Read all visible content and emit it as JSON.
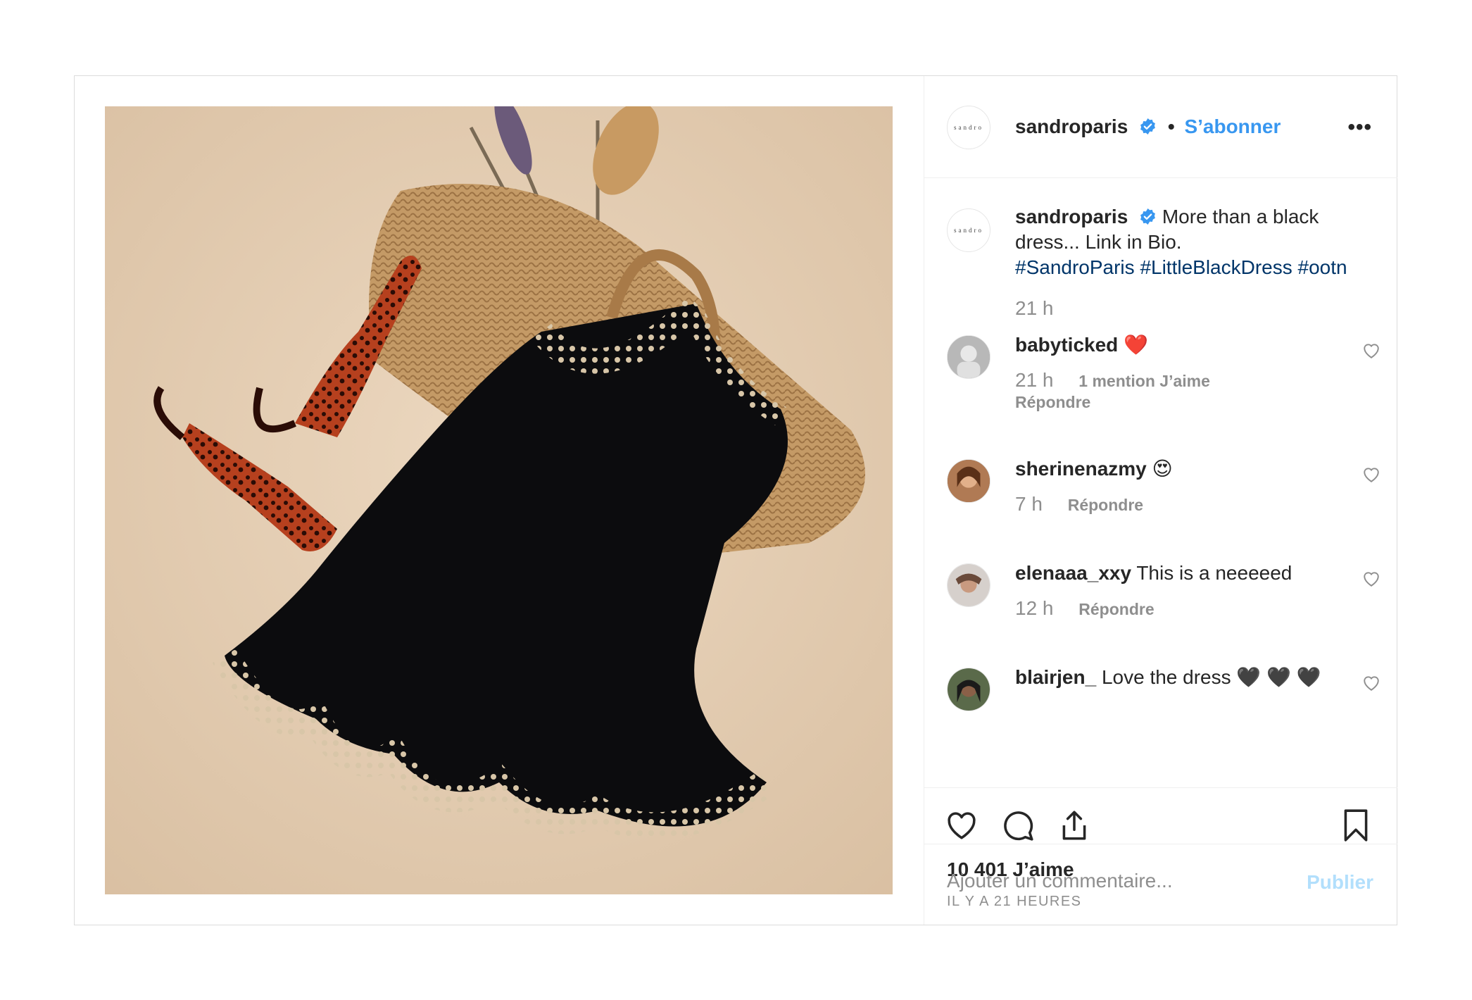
{
  "post": {
    "username": "sandroparis",
    "follow_label": "S’abonner",
    "dot": "•",
    "more_label": "•••",
    "logo_text": "sandro"
  },
  "caption": {
    "username": "sandroparis",
    "text": "More than a black dress... Link in Bio.",
    "text_line1": "More than a black",
    "text_line2": "dress... Link in Bio.",
    "hashtags": [
      "#SandroParis",
      "#LittleBlackDress",
      "#ootn"
    ],
    "time": "21 h"
  },
  "comments": [
    {
      "username": "babyticked",
      "text": "❤️",
      "time": "21 h",
      "likes": "1 mention J’aime",
      "reply": "Répondre"
    },
    {
      "username": "sherinenazmy",
      "text": "😍",
      "time": "7 h",
      "reply": "Répondre"
    },
    {
      "username": "elenaaa_xxy",
      "text": "This is a neeeeed",
      "time": "12 h",
      "reply": "Répondre"
    },
    {
      "username": "blairjen_",
      "text": "Love the dress 🖤 🖤 🖤"
    }
  ],
  "footer": {
    "likes": "10 401 J’aime",
    "posted": "IL Y A 21 HEURES",
    "comment_placeholder": "Ajouter un commentaire...",
    "publish_label": "Publier"
  },
  "colors": {
    "link_blue": "#3897f0",
    "hashtag_blue": "#003569",
    "muted": "#8e8e8e",
    "publish_disabled": "#b2dffc",
    "text": "#262626"
  },
  "icons": [
    "verified-badge-icon",
    "more-options-icon",
    "heart-icon",
    "comment-icon",
    "share-icon",
    "bookmark-icon"
  ]
}
